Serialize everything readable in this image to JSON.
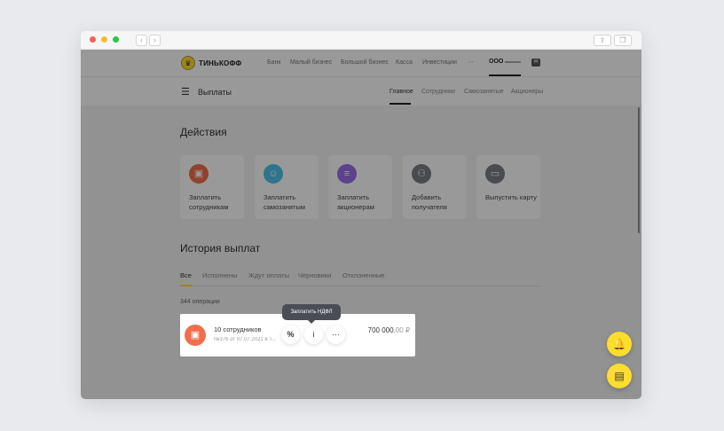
{
  "topnav": {
    "logo_badge": "♛",
    "logo_text": "ТИНЬКОФФ",
    "items": [
      "Банк",
      "Малый бизнес",
      "Большой бизнес",
      "Касса",
      "Инвестиции",
      "···"
    ],
    "org": "ООО"
  },
  "subnav": {
    "title": "Выплаты",
    "tabs": [
      "Главное",
      "Сотрудники",
      "Самозанятые",
      "Акционеры"
    ],
    "active_tab": "Главное"
  },
  "actions": {
    "title": "Действия",
    "cards": [
      {
        "label": "Заплатить сотрудникам",
        "icon": "wallet-icon",
        "color": "#f06e4c"
      },
      {
        "label": "Заплатить самозанятым",
        "icon": "people-icon",
        "color": "#4ec3e8"
      },
      {
        "label": "Заплатить акционерам",
        "icon": "coins-icon",
        "color": "#9b6fe8"
      },
      {
        "label": "Добавить получателя",
        "icon": "add-users-icon",
        "color": "#7a7d84"
      },
      {
        "label": "Выпустить карту",
        "icon": "card-icon",
        "color": "#7a7d84"
      }
    ]
  },
  "history": {
    "title": "История выплат",
    "tabs": [
      "Все",
      "Исполнены",
      "Ждут оплаты",
      "Черновики",
      "Отклоненные"
    ],
    "count": "344 операции",
    "row": {
      "title": "10 сотрудников",
      "subtitle": "№376 от 07.07.2021 в Т...",
      "amount_main": "700 000",
      "amount_cents": ",00 ₽",
      "tooltip": "Заплатить НДФЛ",
      "buttons": [
        "%",
        "i",
        "···"
      ]
    }
  },
  "colors": {
    "accent_yellow": "#ffdd2d",
    "overlay": "rgba(0,0,0,0.4)"
  }
}
